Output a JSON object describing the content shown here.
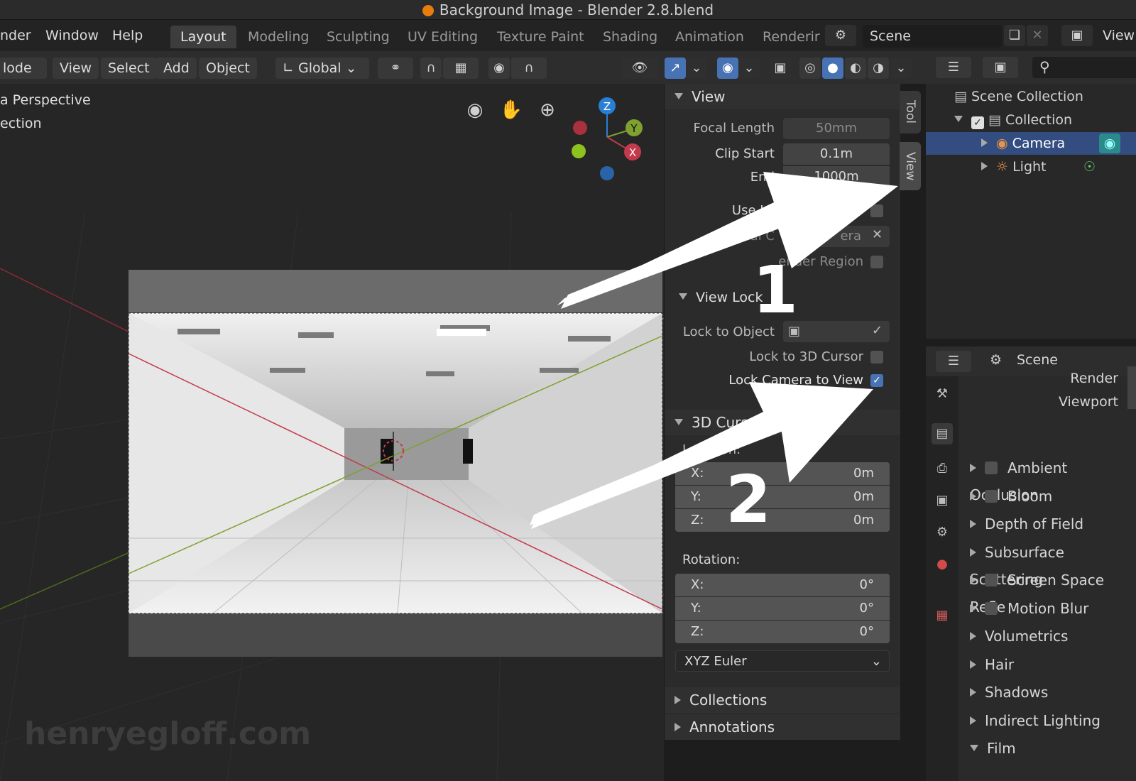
{
  "window": {
    "title": "Background Image - Blender 2.8.blend"
  },
  "menu": {
    "render": "nder",
    "window": "Window",
    "help": "Help"
  },
  "workspaces": [
    "Layout",
    "Modeling",
    "Sculpting",
    "UV Editing",
    "Texture Paint",
    "Shading",
    "Animation",
    "Renderir"
  ],
  "scene_selector": {
    "label": "Scene",
    "view_label": "View"
  },
  "toolbar": {
    "mode": "lode",
    "view": "View",
    "select": "Select",
    "add": "Add",
    "object": "Object",
    "transform_orientation": "Global"
  },
  "viewport": {
    "overlay_line1": "a Perspective",
    "overlay_line2": "ection",
    "gizmo_z": "Z",
    "gizmo_y": "Y",
    "gizmo_x": "X"
  },
  "npanel": {
    "tabs": {
      "tool": "Tool",
      "view": "View"
    },
    "view_section": {
      "title": "View",
      "focal_length_label": "Focal Length",
      "focal_length_value": "50mm",
      "clip_start_label": "Clip Start",
      "clip_start_value": "0.1m",
      "clip_end_label": "End",
      "clip_end_value": "1000m",
      "use_local_label": "Use Lo",
      "use_local_suffix": "a",
      "local_camera_label": "Local C",
      "local_camera_value": "era",
      "render_region_label": "ender Region"
    },
    "view_lock": {
      "title": "View Lock",
      "lock_object_label": "Lock to Object",
      "lock_3d_cursor_label": "Lock to 3D Cursor",
      "lock_camera_label": "Lock Camera to View",
      "lock_camera_checked": true
    },
    "cursor_section": {
      "title": "3D Cursor",
      "location_label": "Location:",
      "location": [
        {
          "axis": "X:",
          "value": "0m"
        },
        {
          "axis": "Y:",
          "value": "0m"
        },
        {
          "axis": "Z:",
          "value": "0m"
        }
      ],
      "rotation_label": "Rotation:",
      "rotation": [
        {
          "axis": "X:",
          "value": "0°"
        },
        {
          "axis": "Y:",
          "value": "0°"
        },
        {
          "axis": "Z:",
          "value": "0°"
        }
      ],
      "rotation_mode": "XYZ Euler"
    },
    "collections_title": "Collections",
    "annotations_title": "Annotations"
  },
  "outliner": {
    "scene_collection": "Scene Collection",
    "collection": "Collection",
    "camera": "Camera",
    "light": "Light"
  },
  "properties": {
    "scene_label": "Scene",
    "render_label": "Render",
    "viewport_label": "Viewport",
    "panels": [
      {
        "label": "Ambient Occlusion",
        "checkbox": true
      },
      {
        "label": "Bloom",
        "checkbox": true
      },
      {
        "label": "Depth of Field",
        "checkbox": false
      },
      {
        "label": "Subsurface Scattering",
        "checkbox": false
      },
      {
        "label": "Screen Space Refle",
        "checkbox": true
      },
      {
        "label": "Motion Blur",
        "checkbox": true
      },
      {
        "label": "Volumetrics",
        "checkbox": false
      },
      {
        "label": "Hair",
        "checkbox": false
      },
      {
        "label": "Shadows",
        "checkbox": false
      },
      {
        "label": "Indirect Lighting",
        "checkbox": false
      },
      {
        "label": "Film",
        "checkbox": false,
        "expanded": true
      }
    ]
  },
  "annotations": {
    "arrow1_number": "1",
    "arrow2_number": "2"
  },
  "watermark": "henryegloff.com",
  "colors": {
    "accent": "#4772b3",
    "selection": "#334d80",
    "x_axis": "#c23a4b",
    "y_axis": "#7fa12f",
    "z_axis": "#2a7fd4"
  }
}
